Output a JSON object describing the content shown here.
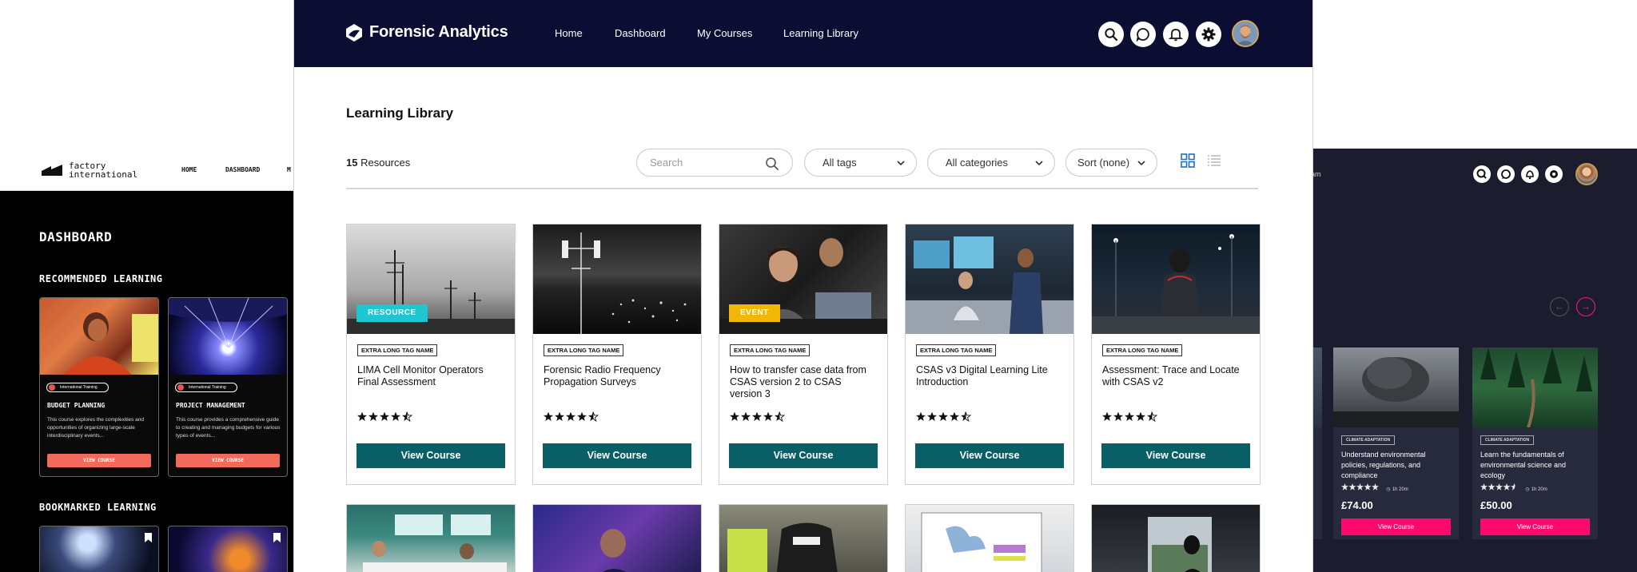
{
  "left_app": {
    "logo_text": "factory\ninternational",
    "nav": [
      "HOME",
      "DASHBOARD",
      "M"
    ],
    "heading": "DASHBOARD",
    "recommended_heading": "RECOMMENDED LEARNING",
    "bookmarked_heading": "BOOKMARKED LEARNING",
    "cards": [
      {
        "pill": "International Training",
        "title": "BUDGET PLANNING",
        "description": "This course explores the complexities and opportunities of organizing large-scale interdisciplinary events...",
        "button": "VIEW COURSE"
      },
      {
        "pill": "International Training",
        "title": "PROJECT MANAGEMENT",
        "description": "This course provides a comprehensive guide to creating and managing budgets for various types of events...",
        "button": "VIEW COURSE"
      }
    ]
  },
  "right_app": {
    "nav_fragment": "am",
    "cards": [
      {
        "tag": "CLIMATE ADAPTATION",
        "title": "Understand environmental policies, regulations, and compliance",
        "duration": "1h 20m",
        "rating": 5,
        "price": "£74.00",
        "button": "View Course"
      },
      {
        "tag": "CLIMATE ADAPTATION",
        "title": "Learn the fundamentals of environmental science and ecology",
        "duration": "1h 20m",
        "rating": 4.5,
        "price": "£50.00",
        "button": "View Course"
      }
    ]
  },
  "main_app": {
    "brand": "Forensic Analytics",
    "nav": [
      "Home",
      "Dashboard",
      "My Courses",
      "Learning Library"
    ],
    "page_title": "Learning Library",
    "resource_count": "15",
    "resource_count_label": "Resources",
    "search_placeholder": "Search",
    "filters": {
      "tags": "All tags",
      "categories": "All categories",
      "sort": "Sort (none)"
    },
    "colors": {
      "header": "#0b0d33",
      "button": "#0a5e66",
      "resource_badge": "#1ec7cf",
      "event_badge": "#f2b705"
    },
    "cards": [
      {
        "badge": "RESOURCE",
        "tag": "EXTRA LONG TAG NAME",
        "title": "LIMA Cell Monitor Operators Final Assessment",
        "rating": 4.5,
        "button": "View Course"
      },
      {
        "badge": "",
        "tag": "EXTRA LONG TAG NAME",
        "title": "Forensic Radio Frequency Propagation Surveys",
        "rating": 4.5,
        "button": "View Course"
      },
      {
        "badge": "EVENT",
        "tag": "EXTRA LONG TAG NAME",
        "title": "How to transfer case data from CSAS version 2 to CSAS version 3",
        "rating": 4.5,
        "button": "View Course"
      },
      {
        "badge": "",
        "tag": "EXTRA LONG TAG NAME",
        "title": "CSAS v3 Digital Learning Lite Introduction",
        "rating": 4.5,
        "button": "View Course"
      },
      {
        "badge": "",
        "tag": "EXTRA LONG TAG NAME",
        "title": "Assessment: Trace and Locate with CSAS v2",
        "rating": 4.5,
        "button": "View Course"
      }
    ]
  }
}
